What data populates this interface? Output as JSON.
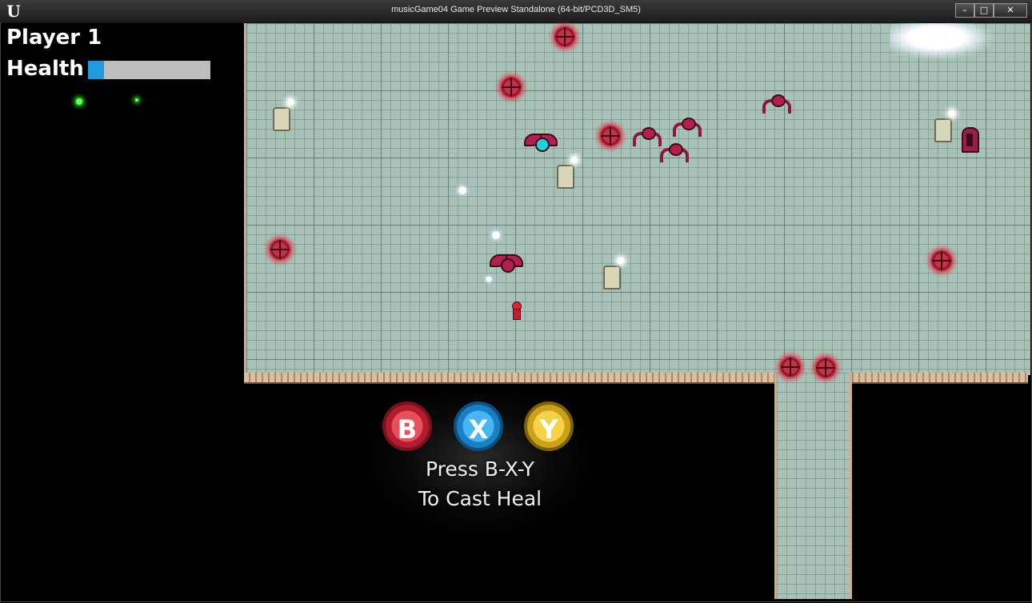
{
  "window": {
    "title": "musicGame04 Game Preview Standalone (64-bit/PCD3D_SM5)",
    "app_icon": "unreal-engine-icon",
    "controls": {
      "minimize": "minimize-icon",
      "maximize": "maximize-icon",
      "close": "close-icon"
    }
  },
  "hud": {
    "player_label": "Player 1",
    "health_label": "Health",
    "health_fraction": 0.13,
    "health_color": "#1e9be0"
  },
  "prompt": {
    "buttons": [
      "B",
      "X",
      "Y"
    ],
    "button_colors": [
      "#b11d2c",
      "#1b7fc4",
      "#c9a11a"
    ],
    "line1": "Press B-X-Y",
    "line2": "To Cast Heal"
  }
}
